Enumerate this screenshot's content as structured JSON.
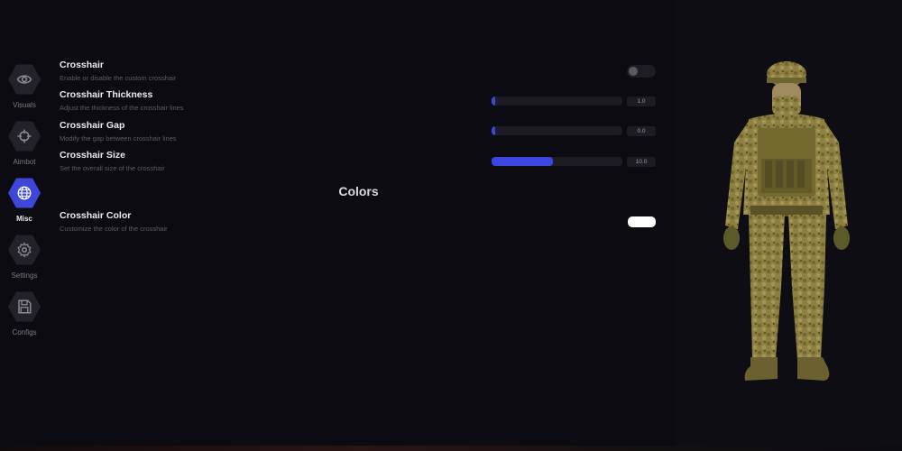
{
  "sidebar": {
    "items": [
      {
        "label": "Visuals",
        "icon": "eye-icon",
        "active": false
      },
      {
        "label": "Aimbot",
        "icon": "crosshair-icon",
        "active": false
      },
      {
        "label": "Misc",
        "icon": "globe-icon",
        "active": true
      },
      {
        "label": "Settings",
        "icon": "gear-icon",
        "active": false
      },
      {
        "label": "Configs",
        "icon": "save-icon",
        "active": false
      }
    ]
  },
  "settings": {
    "crosshair": {
      "title": "Crosshair",
      "description": "Enable or disable the custom crosshair",
      "enabled": false
    },
    "thickness": {
      "title": "Crosshair Thickness",
      "description": "Adjust the thickness of the crosshair lines",
      "value": "1.0",
      "fill_fraction": 0.03
    },
    "gap": {
      "title": "Crosshair Gap",
      "description": "Modify the gap between crosshair lines",
      "value": "0.0",
      "fill_fraction": 0.03
    },
    "size": {
      "title": "Crosshair Size",
      "description": "Set the overall size of the crosshair",
      "value": "10.0",
      "fill_fraction": 0.47
    }
  },
  "colors_section": {
    "heading": "Colors",
    "crosshair_color": {
      "title": "Crosshair Color",
      "description": "Customize the color of the crosshair",
      "color": "#ffffff"
    }
  },
  "theme": {
    "accent": "#3f47d8",
    "background": "#0c0b11"
  }
}
